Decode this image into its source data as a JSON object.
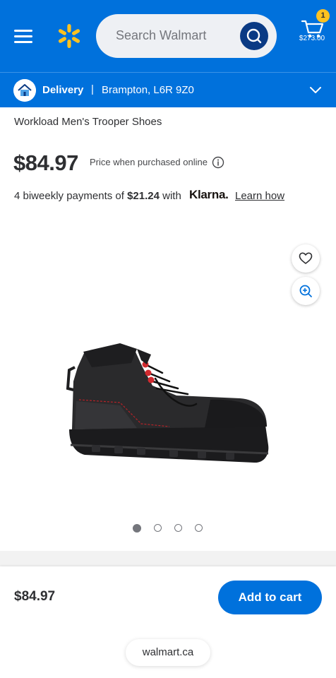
{
  "header": {
    "search_placeholder": "Search Walmart",
    "cart_count": "1",
    "cart_total": "$273.00",
    "brand_color": "#0071dc",
    "spark_color": "#ffc220"
  },
  "delivery": {
    "label": "Delivery",
    "separator": "|",
    "location": "Brampton, L6R 9Z0"
  },
  "product": {
    "title": "Workload Men's Trooper Shoes",
    "price": "$84.97",
    "price_note": "Price when purchased online",
    "klarna": {
      "prefix": "4 biweekly payments of ",
      "amount": "$21.24",
      "mid": " with ",
      "logo": "Klarna.",
      "link": "Learn how"
    },
    "image_count": 4,
    "active_image": 1
  },
  "bottom": {
    "price": "$84.97",
    "add_to_cart": "Add to cart",
    "url": "walmart.ca"
  }
}
